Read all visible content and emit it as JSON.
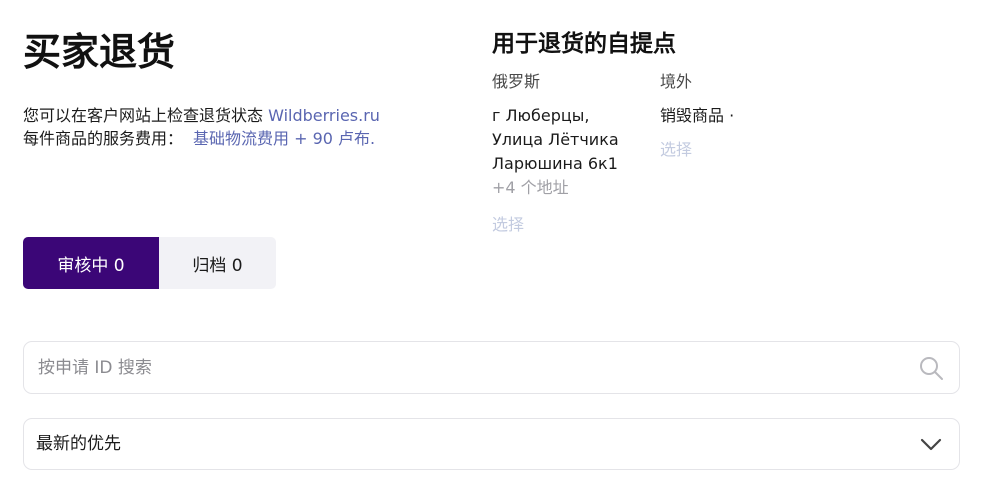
{
  "header": {
    "title": "买家退货",
    "status_text": "您可以在客户网站上检查退货状态",
    "status_link": "Wildberries.ru",
    "fee_label": "每件商品的服务费用：",
    "fee_value": "基础物流费用 + 90 卢布."
  },
  "pickup_points": {
    "title": "用于退货的自提点",
    "russia": {
      "label": "俄罗斯",
      "address_lines": [
        "г Люберцы,",
        "Улица Лётчика",
        "Ларюшина 6к1"
      ],
      "more": "+4 个地址",
      "select_label": "选择"
    },
    "abroad": {
      "label": "境外",
      "value": "销毁商品 ·",
      "select_label": "选择"
    }
  },
  "tabs": [
    {
      "label": "审核中 0",
      "active": true
    },
    {
      "label": "归档 0",
      "active": false
    }
  ],
  "search": {
    "placeholder": "按申请 ID 搜索",
    "value": ""
  },
  "sort": {
    "selected": "最新的优先"
  },
  "icons": {
    "search": "search-icon",
    "chevron": "chevron-down-icon"
  },
  "colors": {
    "accent": "#3b0677",
    "link": "#5a66b1",
    "muted_link": "#c3cbe0",
    "tab_inactive_bg": "#f2f2f6",
    "border": "#e4e4e8"
  }
}
